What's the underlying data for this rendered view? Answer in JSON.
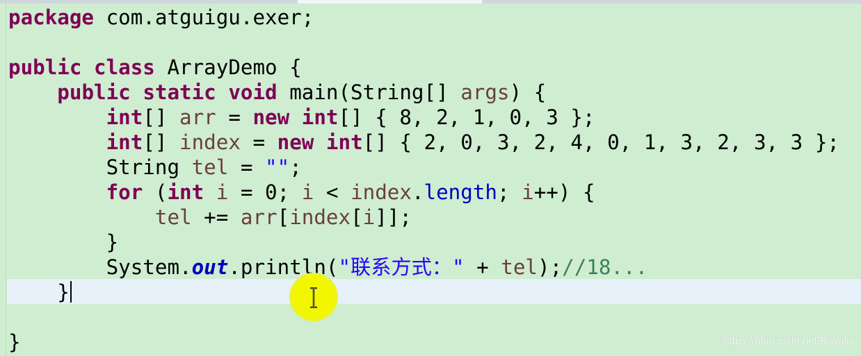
{
  "editor": {
    "language": "java",
    "colors": {
      "background": "#cfedd1",
      "current_line": "#e6f1f9",
      "keyword": "#7f0055",
      "local_variable": "#6a3e3e",
      "field": "#0000c0",
      "string": "#2a00ff",
      "comment": "#3f7f5f"
    },
    "current_line_number": 12,
    "lines": [
      [
        {
          "t": "package",
          "c": "kw"
        },
        {
          "t": " com.atguigu.exer;"
        }
      ],
      [],
      [
        {
          "t": "public",
          "c": "kw"
        },
        {
          "t": " "
        },
        {
          "t": "class",
          "c": "kw"
        },
        {
          "t": " ArrayDemo {"
        }
      ],
      [
        {
          "t": "    "
        },
        {
          "t": "public",
          "c": "kw"
        },
        {
          "t": " "
        },
        {
          "t": "static",
          "c": "kw"
        },
        {
          "t": " "
        },
        {
          "t": "void",
          "c": "kw"
        },
        {
          "t": " main(String[] "
        },
        {
          "t": "args",
          "c": "var"
        },
        {
          "t": ") {"
        }
      ],
      [
        {
          "t": "        "
        },
        {
          "t": "int",
          "c": "kw"
        },
        {
          "t": "[] "
        },
        {
          "t": "arr",
          "c": "var"
        },
        {
          "t": " = "
        },
        {
          "t": "new",
          "c": "kw"
        },
        {
          "t": " "
        },
        {
          "t": "int",
          "c": "kw"
        },
        {
          "t": "[] { 8, 2, 1, 0, 3 };"
        }
      ],
      [
        {
          "t": "        "
        },
        {
          "t": "int",
          "c": "kw"
        },
        {
          "t": "[] "
        },
        {
          "t": "index",
          "c": "var"
        },
        {
          "t": " = "
        },
        {
          "t": "new",
          "c": "kw"
        },
        {
          "t": " "
        },
        {
          "t": "int",
          "c": "kw"
        },
        {
          "t": "[] { 2, 0, 3, 2, 4, 0, 1, 3, 2, 3, 3 };"
        }
      ],
      [
        {
          "t": "        String "
        },
        {
          "t": "tel",
          "c": "var"
        },
        {
          "t": " = "
        },
        {
          "t": "\"\"",
          "c": "str"
        },
        {
          "t": ";"
        }
      ],
      [
        {
          "t": "        "
        },
        {
          "t": "for",
          "c": "kw"
        },
        {
          "t": " ("
        },
        {
          "t": "int",
          "c": "kw"
        },
        {
          "t": " "
        },
        {
          "t": "i",
          "c": "var"
        },
        {
          "t": " = 0; "
        },
        {
          "t": "i",
          "c": "var"
        },
        {
          "t": " < "
        },
        {
          "t": "index",
          "c": "var"
        },
        {
          "t": "."
        },
        {
          "t": "length",
          "c": "field"
        },
        {
          "t": "; "
        },
        {
          "t": "i",
          "c": "var"
        },
        {
          "t": "++) {"
        }
      ],
      [
        {
          "t": "            "
        },
        {
          "t": "tel",
          "c": "var"
        },
        {
          "t": " += "
        },
        {
          "t": "arr",
          "c": "var"
        },
        {
          "t": "["
        },
        {
          "t": "index",
          "c": "var"
        },
        {
          "t": "["
        },
        {
          "t": "i",
          "c": "var"
        },
        {
          "t": "]];"
        }
      ],
      [
        {
          "t": "        }"
        }
      ],
      [
        {
          "t": "        System."
        },
        {
          "t": "out",
          "c": "sfield"
        },
        {
          "t": ".println("
        },
        {
          "t": "\"联系方式：\"",
          "c": "str"
        },
        {
          "t": " + "
        },
        {
          "t": "tel",
          "c": "var"
        },
        {
          "t": ");"
        },
        {
          "t": "//18...",
          "c": "cmt"
        }
      ],
      [
        {
          "t": "    }"
        }
      ],
      [],
      [
        {
          "t": "}"
        }
      ]
    ]
  },
  "watermark": "https://blog.csdn.net/Royalic",
  "cursor": {
    "type": "i-beam-icon",
    "highlight_color": "#f2f700"
  }
}
